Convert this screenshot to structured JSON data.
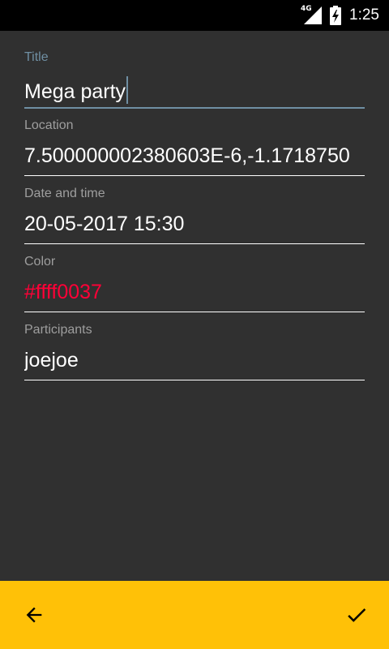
{
  "status_bar": {
    "network_type": "4G",
    "time": "1:25",
    "icons": [
      "signal-icon",
      "battery-charging-icon"
    ]
  },
  "form": {
    "fields": [
      {
        "label": "Title",
        "value": "Mega party",
        "focused": true
      },
      {
        "label": "Location",
        "value": "7.500000002380603E-6,-1.1718750"
      },
      {
        "label": "Date and time",
        "value": "20-05-2017 15:30"
      },
      {
        "label": "Color",
        "value": "#ffff0037"
      },
      {
        "label": "Participants",
        "value": "joejoe"
      }
    ]
  },
  "bottom_bar": {
    "background": "#ffc107",
    "back_icon": "arrow-back-icon",
    "confirm_icon": "check-icon"
  },
  "colors": {
    "accent_focus": "#6f8fa3",
    "color_value": "#ff0037",
    "background": "#303030"
  }
}
